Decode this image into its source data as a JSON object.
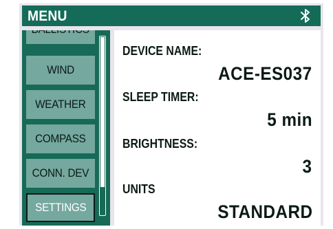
{
  "header": {
    "title": "MENU",
    "status_icon": "bluetooth-icon"
  },
  "sidebar": {
    "items": [
      {
        "label": "BALLISTICS"
      },
      {
        "label": "WIND"
      },
      {
        "label": "WEATHER"
      },
      {
        "label": "COMPASS"
      },
      {
        "label": "CONN. DEV"
      },
      {
        "label": "SETTINGS",
        "selected": true
      }
    ]
  },
  "settings": {
    "device_name": {
      "label": "DEVICE NAME:",
      "value": "ACE-ES037"
    },
    "sleep_timer": {
      "label": "SLEEP TIMER:",
      "value": "5 min"
    },
    "brightness": {
      "label": "BRIGHTNESS:",
      "value": "3"
    },
    "units": {
      "label": "UNITS",
      "value": "STANDARD"
    }
  },
  "colors": {
    "accent": "#146b58",
    "menu_item": "#75a89e",
    "frame": "#e9e5ec",
    "text": "#0b1a16"
  }
}
